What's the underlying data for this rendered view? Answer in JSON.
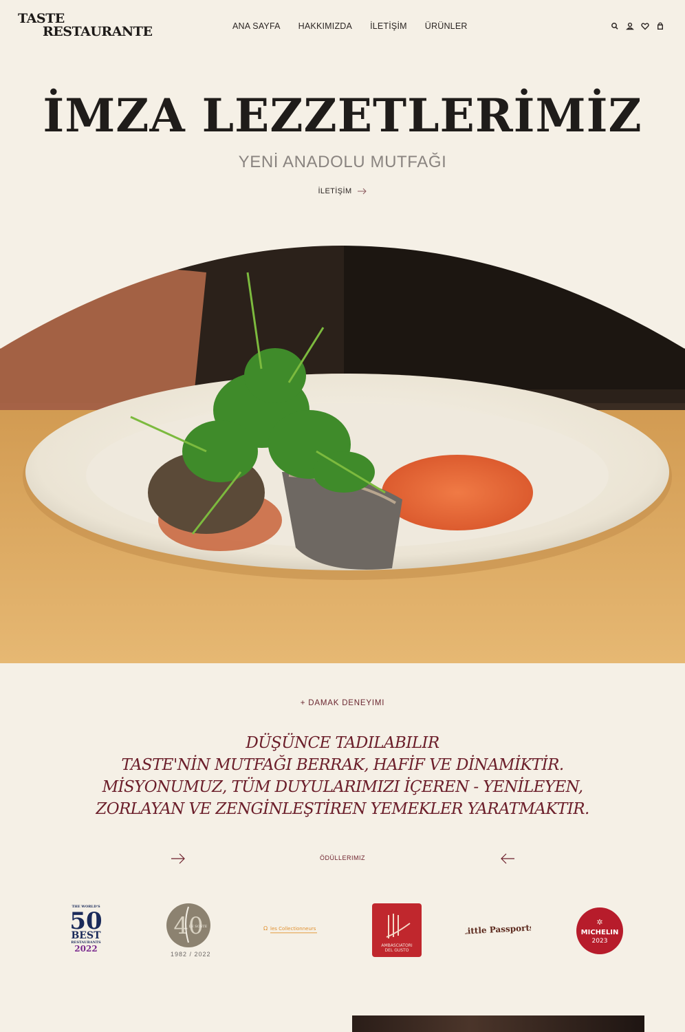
{
  "brand": {
    "line1": "TASTE",
    "line2": "RESTAURANTE"
  },
  "nav": {
    "items": [
      "ANA SAYFA",
      "HAKKIMIZDA",
      "İLETİŞİM",
      "ÜRÜNLER"
    ]
  },
  "header_icons": [
    "search-icon",
    "user-icon",
    "heart-icon",
    "bag-icon"
  ],
  "hero": {
    "title": "İMZA LEZZETLERİMİZ",
    "subtitle": "YENİ ANADOLU MUTFAĞI",
    "cta": "İLETİŞİM"
  },
  "intro": {
    "eyebrow": "+ DAMAK DENEYIMI",
    "lines": [
      "DÜŞÜNCE TADILABILIR",
      "TASTE'NİN MUTFAĞI BERRAK, HAFİF VE DİNAMİKTİR.",
      "MİSYONUMUZ, TÜM DUYULARIMIZI İÇEREN - YENİLEYEN,",
      "ZORLAYAN VE ZENGİNLEŞTİREN YEMEKLER YARATMAKTIR."
    ]
  },
  "awards": {
    "label": "ÖDÜLLERIMIZ",
    "items": [
      {
        "name": "the-worlds-50-best-logo",
        "line1": "THE WORLD'S",
        "num": "50",
        "line2": "BEST",
        "line3": "RESTAURANTS",
        "year": "2022"
      },
      {
        "name": "le-soste-logo",
        "caption": "1982 / 2022",
        "inner": "LE SOSTE"
      },
      {
        "name": "les-collectionneurs-logo",
        "text": "les Collectionneurs"
      },
      {
        "name": "ambasciatori-del-gusto-logo",
        "text1": "AMBASCIATORI",
        "text2": "DEL GUSTO"
      },
      {
        "name": "little-passports-logo",
        "text": "Little Passports"
      },
      {
        "name": "michelin-logo",
        "text": "MICHELIN",
        "year": "2023"
      }
    ]
  },
  "colors": {
    "background": "#f5f0e6",
    "accent": "#6b1e2a",
    "michelin_red": "#b71c2b",
    "ambasciatori_red": "#c0272d"
  }
}
